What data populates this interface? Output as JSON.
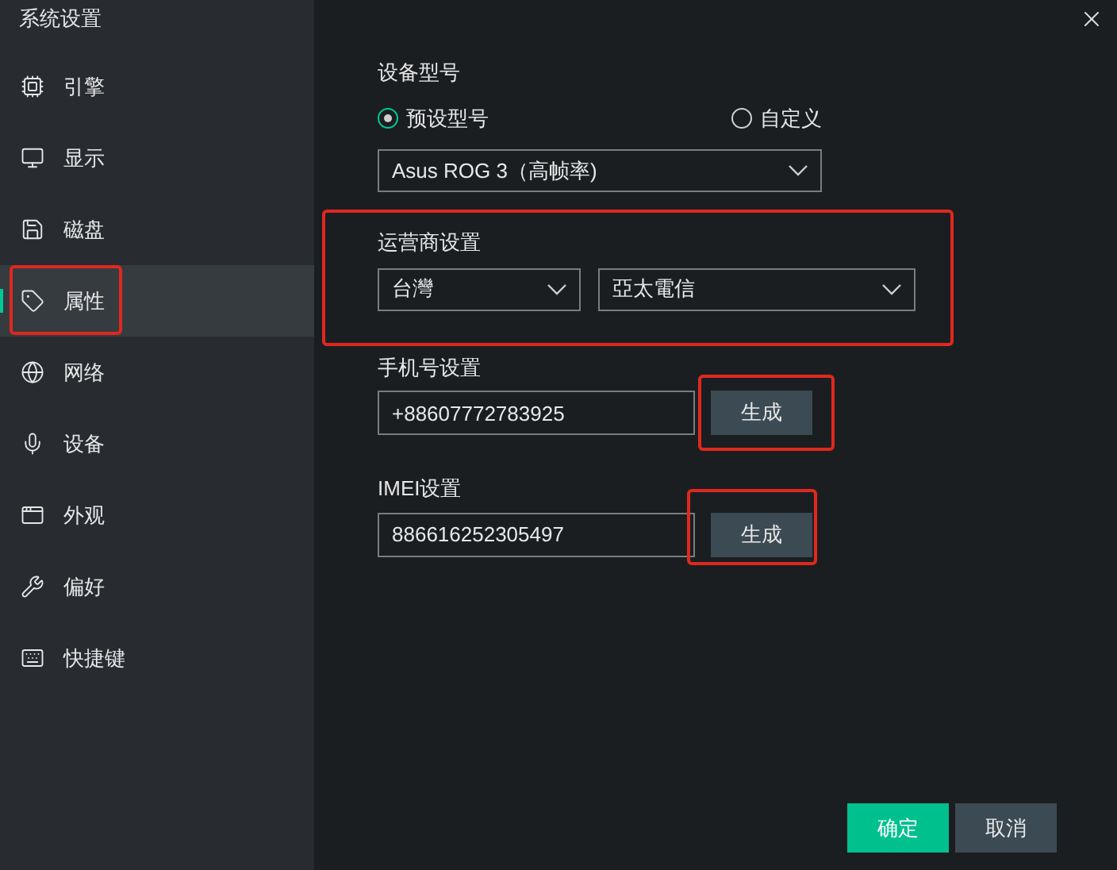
{
  "window": {
    "title": "系统设置"
  },
  "sidebar": {
    "items": [
      {
        "kind": "cpu",
        "label": "引擎",
        "selected": false,
        "highlighted": false
      },
      {
        "kind": "monitor",
        "label": "显示",
        "selected": false,
        "highlighted": false
      },
      {
        "kind": "disk",
        "label": "磁盘",
        "selected": false,
        "highlighted": false
      },
      {
        "kind": "tag",
        "label": "属性",
        "selected": true,
        "highlighted": true
      },
      {
        "kind": "globe",
        "label": "网络",
        "selected": false,
        "highlighted": false
      },
      {
        "kind": "device",
        "label": "设备",
        "selected": false,
        "highlighted": false
      },
      {
        "kind": "window",
        "label": "外观",
        "selected": false,
        "highlighted": false
      },
      {
        "kind": "wrench",
        "label": "偏好",
        "selected": false,
        "highlighted": false
      },
      {
        "kind": "keyboard",
        "label": "快捷键",
        "selected": false,
        "highlighted": false
      }
    ]
  },
  "device_model": {
    "label": "设备型号",
    "options": [
      {
        "label": "预设型号",
        "selected": true
      },
      {
        "label": "自定义",
        "selected": false
      }
    ],
    "value": "Asus ROG 3（高帧率)"
  },
  "carrier": {
    "label": "运营商设置",
    "highlighted": true,
    "region": "台灣",
    "operator": "亞太電信"
  },
  "phone": {
    "label": "手机号设置",
    "value": "+88607772783925",
    "button": "生成",
    "highlighted": true
  },
  "imei": {
    "label": "IMEI设置",
    "value": "886616252305497",
    "button": "生成",
    "highlighted": true
  },
  "buttons": [
    {
      "kind": "primary",
      "label": "确定"
    },
    {
      "kind": "secondary",
      "label": "取消"
    }
  ]
}
